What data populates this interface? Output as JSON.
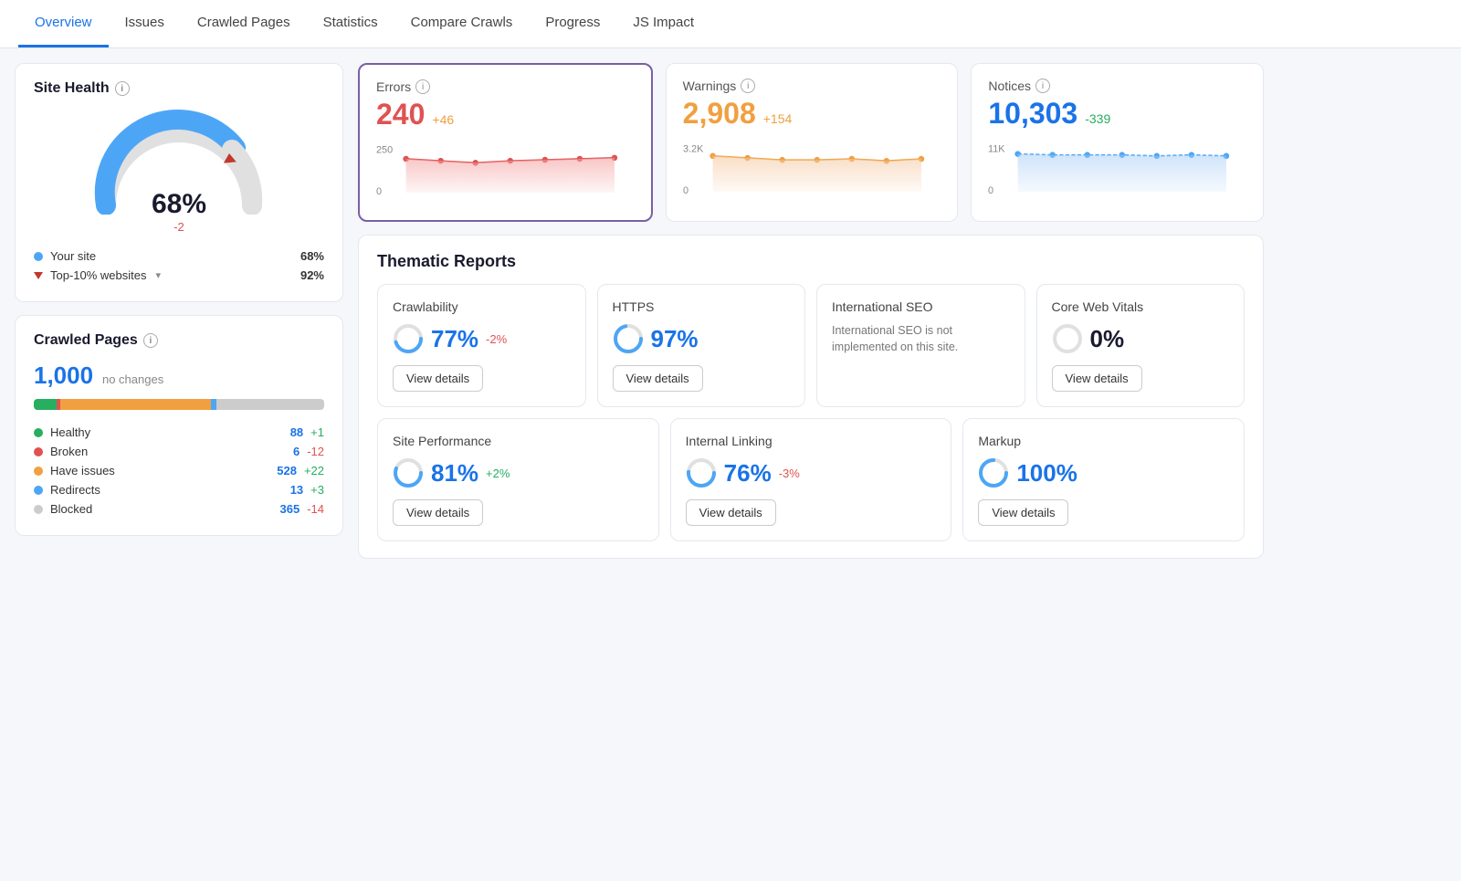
{
  "nav": {
    "items": [
      {
        "label": "Overview",
        "active": true
      },
      {
        "label": "Issues",
        "active": false
      },
      {
        "label": "Crawled Pages",
        "active": false
      },
      {
        "label": "Statistics",
        "active": false
      },
      {
        "label": "Compare Crawls",
        "active": false
      },
      {
        "label": "Progress",
        "active": false
      },
      {
        "label": "JS Impact",
        "active": false
      }
    ]
  },
  "site_health": {
    "title": "Site Health",
    "percent": "68%",
    "delta": "-2",
    "legend": [
      {
        "label": "Your site",
        "value": "68%",
        "type": "dot",
        "color": "#4da6f5"
      },
      {
        "label": "Top-10% websites",
        "value": "92%",
        "type": "triangle",
        "color": "#c0392b",
        "hasChevron": true
      }
    ]
  },
  "crawled_pages": {
    "title": "Crawled Pages",
    "count": "1,000",
    "no_change_label": "no changes",
    "bar_segments": [
      {
        "color": "#27ae60",
        "pct": 8
      },
      {
        "color": "#e05252",
        "pct": 1
      },
      {
        "color": "#f0a040",
        "pct": 52
      },
      {
        "color": "#4da6f5",
        "pct": 2
      },
      {
        "color": "#ccc",
        "pct": 37
      }
    ],
    "stats": [
      {
        "label": "Healthy",
        "color": "#27ae60",
        "value": "88",
        "delta": "+1",
        "delta_type": "pos"
      },
      {
        "label": "Broken",
        "color": "#e05252",
        "value": "6",
        "delta": "-12",
        "delta_type": "neg"
      },
      {
        "label": "Have issues",
        "color": "#f0a040",
        "value": "528",
        "delta": "+22",
        "delta_type": "pos"
      },
      {
        "label": "Redirects",
        "color": "#4da6f5",
        "value": "13",
        "delta": "+3",
        "delta_type": "pos"
      },
      {
        "label": "Blocked",
        "color": "#ccc",
        "value": "365",
        "delta": "-14",
        "delta_type": "neg"
      }
    ]
  },
  "metrics": {
    "errors": {
      "label": "Errors",
      "value": "240",
      "delta": "+46",
      "delta_type": "pos_bad",
      "highlighted": true,
      "chart_top_label": "250",
      "chart_bottom_label": "0",
      "color": "#e05252"
    },
    "warnings": {
      "label": "Warnings",
      "value": "2,908",
      "delta": "+154",
      "delta_type": "pos_bad",
      "highlighted": false,
      "chart_top_label": "3.2K",
      "chart_bottom_label": "0",
      "color": "#f0a040"
    },
    "notices": {
      "label": "Notices",
      "value": "10,303",
      "delta": "-339",
      "delta_type": "neg_good",
      "highlighted": false,
      "chart_top_label": "11K",
      "chart_bottom_label": "0",
      "color": "#4da6f5"
    }
  },
  "thematic": {
    "title": "Thematic Reports",
    "top_reports": [
      {
        "name": "Crawlability",
        "score": "77%",
        "delta": "-2%",
        "delta_type": "neg",
        "show_button": true,
        "button_label": "View details",
        "color": "#4da6f5",
        "percent_num": 77
      },
      {
        "name": "HTTPS",
        "score": "97%",
        "delta": "",
        "delta_type": "none",
        "show_button": true,
        "button_label": "View details",
        "color": "#4da6f5",
        "percent_num": 97
      },
      {
        "name": "International SEO",
        "score": "",
        "delta": "",
        "delta_type": "none",
        "show_button": false,
        "button_label": "",
        "desc": "International SEO is not implemented on this site.",
        "color": "#ccc",
        "percent_num": 0
      },
      {
        "name": "Core Web Vitals",
        "score": "0%",
        "delta": "",
        "delta_type": "none",
        "show_button": true,
        "button_label": "View details",
        "color": "#ccc",
        "percent_num": 0
      }
    ],
    "bottom_reports": [
      {
        "name": "Site Performance",
        "score": "81%",
        "delta": "+2%",
        "delta_type": "pos",
        "show_button": true,
        "button_label": "View details",
        "color": "#4da6f5",
        "percent_num": 81
      },
      {
        "name": "Internal Linking",
        "score": "76%",
        "delta": "-3%",
        "delta_type": "neg",
        "show_button": true,
        "button_label": "View details",
        "color": "#4da6f5",
        "percent_num": 76
      },
      {
        "name": "Markup",
        "score": "100%",
        "delta": "",
        "delta_type": "none",
        "show_button": true,
        "button_label": "View details",
        "color": "#4da6f5",
        "percent_num": 100
      }
    ]
  }
}
